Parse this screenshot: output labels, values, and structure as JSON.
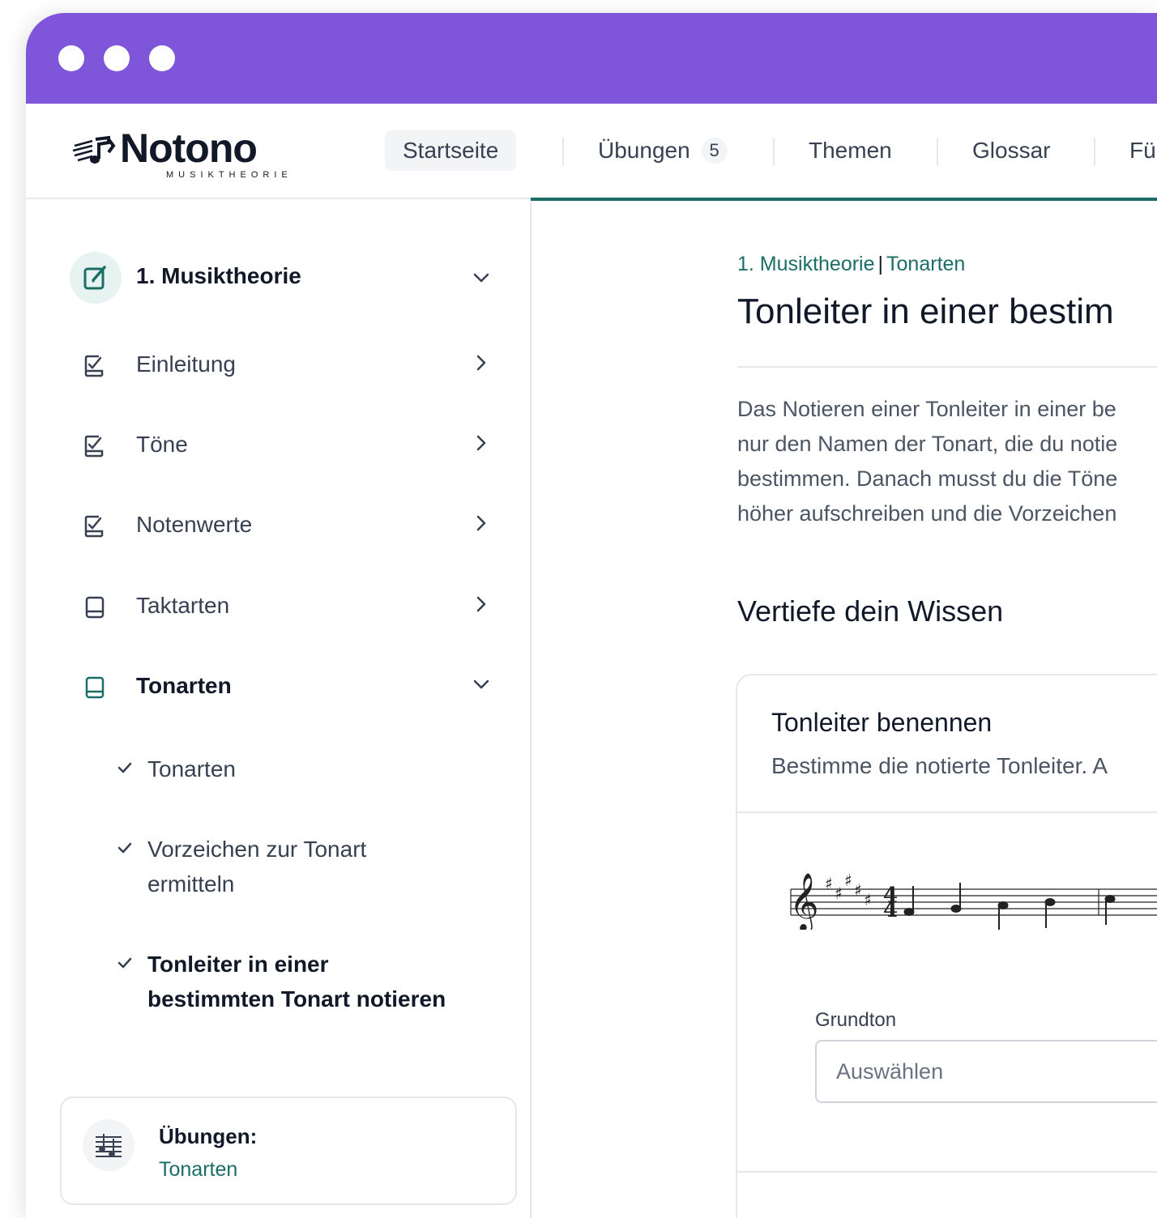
{
  "logo": {
    "name": "Notono",
    "tagline": "MUSIKTHEORIE"
  },
  "nav": {
    "items": [
      {
        "label": "Startseite",
        "active": true
      },
      {
        "label": "Übungen",
        "badge": "5"
      },
      {
        "label": "Themen"
      },
      {
        "label": "Glossar"
      },
      {
        "label": "Fü"
      }
    ]
  },
  "sidebar": {
    "section_title": "1. Musiktheorie",
    "items": [
      {
        "label": "Einleitung"
      },
      {
        "label": "Töne"
      },
      {
        "label": "Notenwerte"
      },
      {
        "label": "Taktarten"
      },
      {
        "label": "Tonarten"
      }
    ],
    "subitems": [
      {
        "label": "Tonarten"
      },
      {
        "label": "Vorzeichen zur Tonart ermitteln"
      },
      {
        "label": "Tonleiter in einer bestimmten Tonart notieren"
      }
    ],
    "exercise_card": {
      "title": "Übungen:",
      "subtitle": "Tonarten"
    }
  },
  "main": {
    "breadcrumb": {
      "part1": "1. Musiktheorie",
      "separator": "|",
      "part2": "Tonarten"
    },
    "title": "Tonleiter in einer bestim",
    "paragraph": [
      "Das Notieren einer Tonleiter in einer be",
      "nur den Namen der Tonart, die du notie",
      "bestimmen. Danach musst du die Töne",
      "höher aufschreiben und die Vorzeichen"
    ],
    "section_heading": "Vertiefe dein Wissen",
    "card": {
      "title": "Tonleiter benennen",
      "subtitle": "Bestimme die notierte Tonleiter. A",
      "field_label": "Grundton",
      "select_placeholder": "Auswählen"
    }
  },
  "colors": {
    "titlebar": "#7F56D9",
    "accent": "#1B6E66"
  }
}
